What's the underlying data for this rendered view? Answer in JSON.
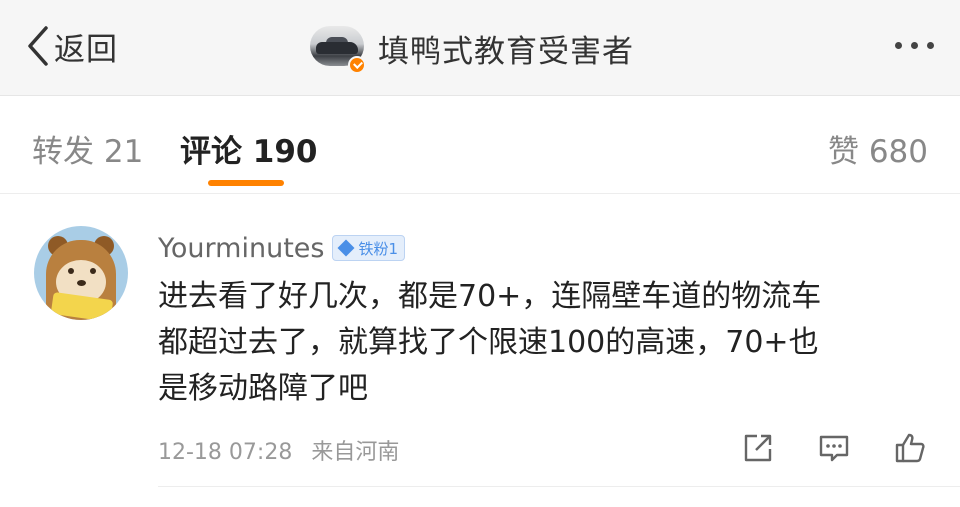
{
  "navbar": {
    "back_label": "返回",
    "title": "填鸭式教育受害者",
    "more_icon": "more-dots-icon"
  },
  "tabs": {
    "repost": "转发 21",
    "comment": "评论 190",
    "like": "赞 680",
    "active": "comment",
    "accent_color": "#ff8200"
  },
  "comment": {
    "username": "Yourminutes",
    "fan_badge": "铁粉1",
    "text_lines": [
      "进去看了好几次，都是70+，连隔壁车道的物流车",
      "都超过去了，就算找了个限速100的高速，70+也",
      "是移动路障了吧"
    ],
    "timestamp": "12-18 07:28",
    "source": "来自河南",
    "actions": [
      "share-icon",
      "comment-icon",
      "like-icon"
    ]
  }
}
